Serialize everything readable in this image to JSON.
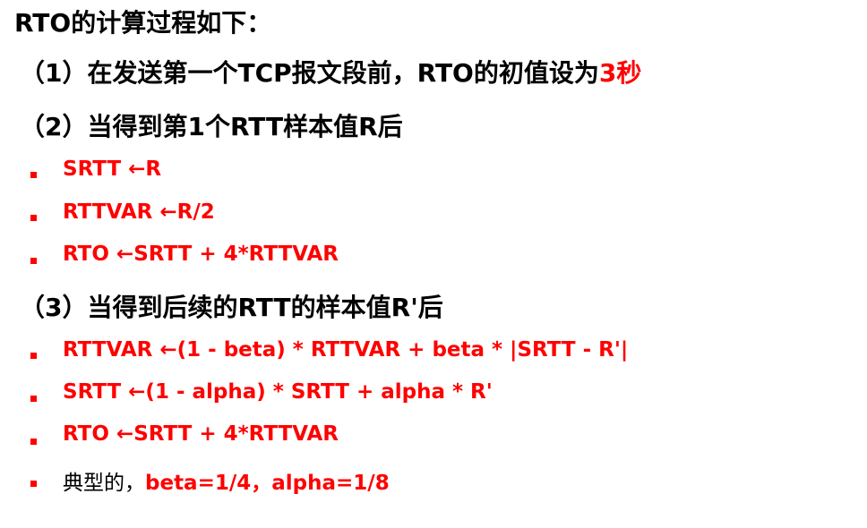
{
  "title": "RTO的计算过程如下：",
  "step1": {
    "prefix": "（1）在发送第一个TCP报文段前，RTO的初值设为",
    "highlight": "3秒"
  },
  "step2": "（2）当得到第1个RTT样本值R后",
  "step2_items": [
    "SRTT ←R",
    "RTTVAR ←R/2",
    "RTO ←SRTT + 4*RTTVAR"
  ],
  "step3": "（3）当得到后续的RTT的样本值R'后",
  "step3_items": [
    "RTTVAR ←(1 - beta) * RTTVAR + beta * |SRTT - R'|",
    "SRTT ←(1 - alpha) * SRTT + alpha * R'",
    "RTO ←SRTT + 4*RTTVAR"
  ],
  "typical": {
    "prefix": "典型的，",
    "values": "beta=1/4，alpha=1/8"
  },
  "colors": {
    "accent": "#ff0000",
    "text": "#000000"
  }
}
